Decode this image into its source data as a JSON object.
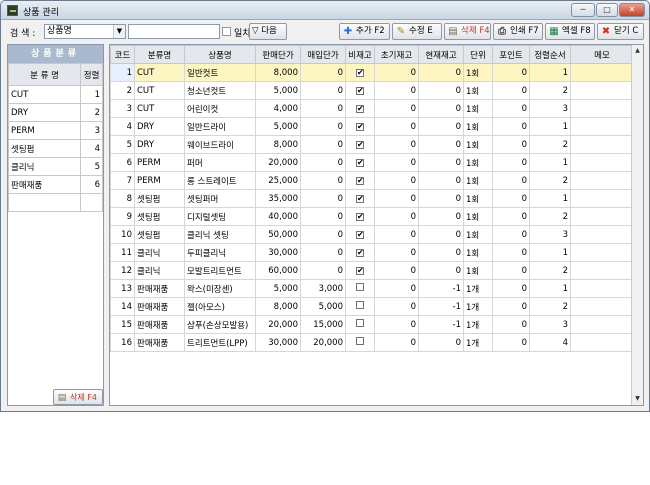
{
  "window": {
    "title": "상품 관리",
    "controls": {
      "minimize": "─",
      "maximize": "□",
      "close": "✕"
    }
  },
  "toolbar": {
    "search_label": "검  색 :",
    "search_field_value": "상품명",
    "search_text": "",
    "match_label": "일치",
    "match_checked": false,
    "next_label": "▽ 다음",
    "add_label": "추가 F2",
    "edit_label": "수정 E",
    "delete_label": "삭제 F4",
    "print_label": "인쇄 F7",
    "excel_label": "엑셀 F8",
    "close_label": "닫기 C",
    "icons": {
      "add": "plus-icon",
      "edit": "pencil-icon",
      "delete": "trash-icon",
      "print": "printer-icon",
      "excel": "spreadsheet-icon",
      "close": "x-icon"
    }
  },
  "category_panel": {
    "header": "상품분류",
    "columns": [
      "분 류 명",
      "정렬"
    ],
    "rows": [
      {
        "name": "CUT",
        "order": "1"
      },
      {
        "name": "DRY",
        "order": "2"
      },
      {
        "name": "PERM",
        "order": "3"
      },
      {
        "name": "셋팅펌",
        "order": "4"
      },
      {
        "name": "클리닉",
        "order": "5"
      },
      {
        "name": "판매재품",
        "order": "6"
      }
    ],
    "delete_label": "삭제 F4"
  },
  "grid": {
    "columns": [
      "코드",
      "분류명",
      "상품명",
      "판매단가",
      "매입단가",
      "비재고",
      "초기재고",
      "현재재고",
      "단위",
      "포인트",
      "정렬순서",
      "메모"
    ],
    "rows": [
      {
        "code": "1",
        "category": "CUT",
        "name": "일반컷트",
        "sale": "8,000",
        "buy": "0",
        "nonstock": true,
        "init": "0",
        "current": "0",
        "unit": "1회",
        "point": "0",
        "order": "1",
        "memo": ""
      },
      {
        "code": "2",
        "category": "CUT",
        "name": "청소년컷트",
        "sale": "5,000",
        "buy": "0",
        "nonstock": true,
        "init": "0",
        "current": "0",
        "unit": "1회",
        "point": "0",
        "order": "2",
        "memo": ""
      },
      {
        "code": "3",
        "category": "CUT",
        "name": "어린이컷",
        "sale": "4,000",
        "buy": "0",
        "nonstock": true,
        "init": "0",
        "current": "0",
        "unit": "1회",
        "point": "0",
        "order": "3",
        "memo": ""
      },
      {
        "code": "4",
        "category": "DRY",
        "name": "일반드라이",
        "sale": "5,000",
        "buy": "0",
        "nonstock": true,
        "init": "0",
        "current": "0",
        "unit": "1회",
        "point": "0",
        "order": "1",
        "memo": ""
      },
      {
        "code": "5",
        "category": "DRY",
        "name": "웨이브드라이",
        "sale": "8,000",
        "buy": "0",
        "nonstock": true,
        "init": "0",
        "current": "0",
        "unit": "1회",
        "point": "0",
        "order": "2",
        "memo": ""
      },
      {
        "code": "6",
        "category": "PERM",
        "name": "퍼머",
        "sale": "20,000",
        "buy": "0",
        "nonstock": true,
        "init": "0",
        "current": "0",
        "unit": "1회",
        "point": "0",
        "order": "1",
        "memo": ""
      },
      {
        "code": "7",
        "category": "PERM",
        "name": "롱 스트레이트",
        "sale": "25,000",
        "buy": "0",
        "nonstock": true,
        "init": "0",
        "current": "0",
        "unit": "1회",
        "point": "0",
        "order": "2",
        "memo": ""
      },
      {
        "code": "8",
        "category": "셋팅펌",
        "name": "셋팅퍼머",
        "sale": "35,000",
        "buy": "0",
        "nonstock": true,
        "init": "0",
        "current": "0",
        "unit": "1회",
        "point": "0",
        "order": "1",
        "memo": ""
      },
      {
        "code": "9",
        "category": "셋팅펌",
        "name": "디지털셋팅",
        "sale": "40,000",
        "buy": "0",
        "nonstock": true,
        "init": "0",
        "current": "0",
        "unit": "1회",
        "point": "0",
        "order": "2",
        "memo": ""
      },
      {
        "code": "10",
        "category": "셋팅펌",
        "name": "클리닉 셋팅",
        "sale": "50,000",
        "buy": "0",
        "nonstock": true,
        "init": "0",
        "current": "0",
        "unit": "1회",
        "point": "0",
        "order": "3",
        "memo": ""
      },
      {
        "code": "11",
        "category": "클리닉",
        "name": "두피클리닉",
        "sale": "30,000",
        "buy": "0",
        "nonstock": true,
        "init": "0",
        "current": "0",
        "unit": "1회",
        "point": "0",
        "order": "1",
        "memo": ""
      },
      {
        "code": "12",
        "category": "클리닉",
        "name": "모발트리트먼트",
        "sale": "60,000",
        "buy": "0",
        "nonstock": true,
        "init": "0",
        "current": "0",
        "unit": "1회",
        "point": "0",
        "order": "2",
        "memo": ""
      },
      {
        "code": "13",
        "category": "판매재품",
        "name": "왁스(미장센)",
        "sale": "5,000",
        "buy": "3,000",
        "nonstock": false,
        "init": "0",
        "current": "-1",
        "unit": "1개",
        "point": "0",
        "order": "1",
        "memo": ""
      },
      {
        "code": "14",
        "category": "판매재품",
        "name": "젤(아모스)",
        "sale": "8,000",
        "buy": "5,000",
        "nonstock": false,
        "init": "0",
        "current": "-1",
        "unit": "1개",
        "point": "0",
        "order": "2",
        "memo": ""
      },
      {
        "code": "15",
        "category": "판매재품",
        "name": "샴푸(손상모발용)",
        "sale": "20,000",
        "buy": "15,000",
        "nonstock": false,
        "init": "0",
        "current": "-1",
        "unit": "1개",
        "point": "0",
        "order": "3",
        "memo": ""
      },
      {
        "code": "16",
        "category": "판매재품",
        "name": "트리트먼트(LPP)",
        "sale": "30,000",
        "buy": "20,000",
        "nonstock": false,
        "init": "0",
        "current": "0",
        "unit": "1개",
        "point": "0",
        "order": "4",
        "memo": ""
      }
    ],
    "selected_row": 0
  },
  "colors": {
    "selected_row": "#fdf5c2",
    "panel_header": "#aab9ce",
    "header_bg": "#e4e7ec"
  }
}
